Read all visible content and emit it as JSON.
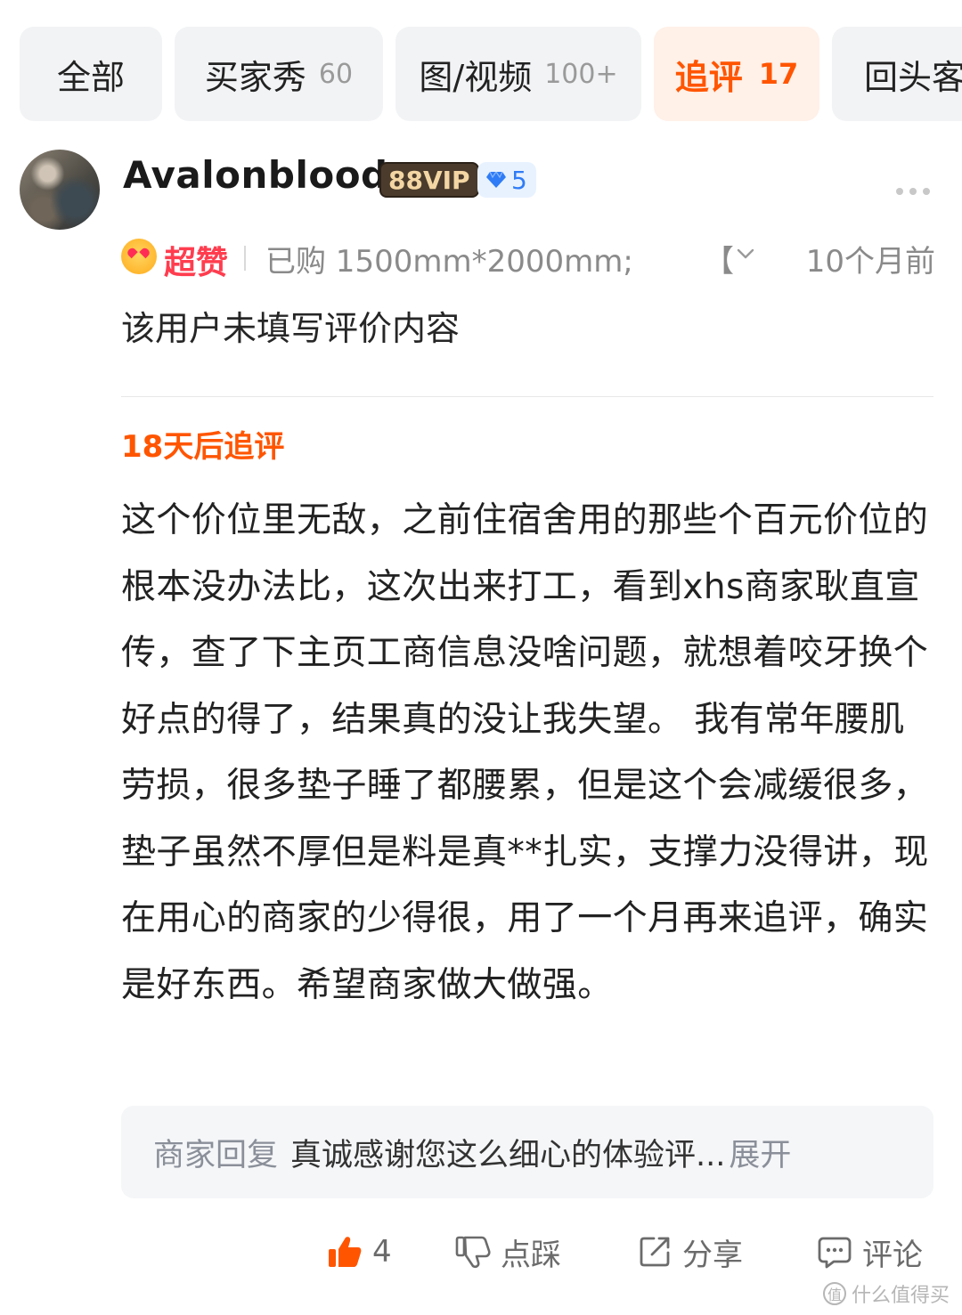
{
  "tabs": [
    {
      "label": "全部",
      "count": ""
    },
    {
      "label": "买家秀",
      "count": "60"
    },
    {
      "label": "图/视频",
      "count": "100+"
    },
    {
      "label": "追评",
      "count": "17"
    },
    {
      "label": "回头客",
      "count": ""
    }
  ],
  "active_tab": "追评",
  "colors": {
    "accent": "#ff5500",
    "rating": "#ff3d4f",
    "level": "#2f7cf6",
    "vip_bg": "#4a3b2c"
  },
  "review": {
    "username": "Avalonblood",
    "vip_badge": "88VIP",
    "level": "5",
    "rating_label": "超赞",
    "purchase_info": "已购 1500mm*2000mm;",
    "purchase_more": "【",
    "time": "10个月前",
    "content": "该用户未填写评价内容",
    "followup_label": "18天后追评",
    "followup_text": "这个价位里无敌，之前住宿舍用的那些个百元价位的根本没办法比，这次出来打工，看到xhs商家耿直宣传，查了下主页工商信息没啥问题，就想着咬牙换个好点的得了，结果真的没让我失望。 我有常年腰肌劳损，很多垫子睡了都腰累，但是这个会减缓很多，垫子虽然不厚但是料是真**扎实，支撑力没得讲，现在用心的商家的少得很，用了一个月再来追评，确实是好东西。希望商家做大做强。",
    "merchant_reply": {
      "label": "商家回复",
      "text": "真诚感谢您这么细心的体验评...",
      "expand": "展开"
    }
  },
  "actions": {
    "like_count": "4",
    "dislike_label": "点踩",
    "share_label": "分享",
    "comment_label": "评论"
  },
  "watermark": {
    "logo": "值",
    "text": "什么值得买"
  },
  "icons": [
    "avatar",
    "gem-icon",
    "more-icon",
    "love-eyes-emoji-icon",
    "chevron-down-icon",
    "thumb-up-icon",
    "thumb-down-icon",
    "share-icon",
    "comment-icon"
  ]
}
